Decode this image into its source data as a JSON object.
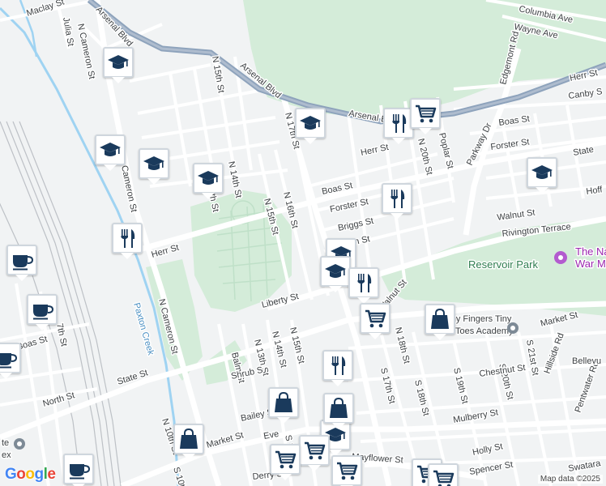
{
  "map": {
    "copyright": "Map data ©2025",
    "logo_letters": [
      "G",
      "o",
      "o",
      "g",
      "l",
      "e"
    ],
    "colors": {
      "background": "#f1f3f4",
      "road": "#ffffff",
      "arterial": "#8ea3bc",
      "park": "#d4ecd9",
      "marker_fill": "#1a3a5c",
      "rail": "#9aa0a6"
    }
  },
  "places": {
    "reservoir_park": "Reservoir Park",
    "museum_line1": "The Na",
    "museum_line2": "War M",
    "academy_line1": "Tiny Fingers Tiny",
    "academy_line2": "Toes Academy",
    "bellevue": "Bellevu",
    "paxton_creek": "Paxton Creek",
    "state_complex_line1": "te",
    "state_complex_line2": "ex"
  },
  "streets": {
    "maclay": "Maclay St",
    "julia": "Julia St",
    "n_cameron_top": "N Cameron St",
    "arsenal_blvd_top": "Arsenal Blvd",
    "arsenal_blvd_mid": "Arsenal Blvd",
    "arsenal_blvd_right": "Arsenal B",
    "n_15th_top": "N 15th St",
    "n_17th": "N 17th St",
    "columbia": "Columbia Ave",
    "wayne": "Wayne Ave",
    "edgemont": "Edgemont Rd",
    "herr_right": "Herr St",
    "canby": "Canby S",
    "boas_right": "Boas St",
    "forster_right": "Forster St",
    "state_right": "State",
    "hoff": "Hoff",
    "parkway": "Parkway Dr",
    "poplar": "Poplar St",
    "n_20th": "N 20th St",
    "herr_mid": "Herr St",
    "cameron_mid": "Cameron St",
    "n_14th_top": "N 14th St",
    "n_13th_top": "13th St",
    "boas_mid": "Boas St",
    "forster_mid": "Forster St",
    "briggs": "Briggs St",
    "n_16th": "N 16th St",
    "n_15th_mid": "N 15th St",
    "walnut_right": "Walnut St",
    "rivington": "Rivington Terrace",
    "n_19th": "n St",
    "herr_left": "Herr St",
    "n_cameron_mid": "N Cameron St",
    "liberty": "Liberty St",
    "walnut_mid": "Walnut St",
    "north_14th": "North St",
    "n_18th": "N 18th St",
    "s_17th": "S 17th St",
    "market_right": "Market St",
    "s_21st": "S 21st St",
    "boas_left": "Boas St",
    "n_7th": "7th St",
    "n_15th_low": "N 15th St",
    "n_14th_low": "N 14th St",
    "n_13th_low": "N 13th St",
    "balm": "Balm St",
    "s_18th": "S 18th St",
    "s_19th": "S 19th St",
    "s_20th": "S 20th St",
    "chestnut": "Chestnut St",
    "hillside": "Hillside Rd",
    "pentwater": "Pentwater Rd",
    "state_left": "State St",
    "north_left": "North St",
    "shrub": "Shrub S",
    "bailey": "Bailey S",
    "mulberry": "Mulberry St",
    "n_10th": "N 10th St",
    "market_left": "Market St",
    "holly": "Holly St",
    "mayflower": "Mayflower St",
    "spencer": "Spencer St",
    "derry": "Derry St",
    "swatara": "Swatara",
    "s_10th": "S 10t",
    "s_13th": "S 13",
    "eve": "Eve"
  },
  "markers": [
    {
      "type": "school",
      "icon": "graduation-cap-icon"
    },
    {
      "type": "school",
      "icon": "graduation-cap-icon"
    },
    {
      "type": "school",
      "icon": "graduation-cap-icon"
    },
    {
      "type": "school",
      "icon": "graduation-cap-icon"
    },
    {
      "type": "school",
      "icon": "graduation-cap-icon"
    },
    {
      "type": "school",
      "icon": "graduation-cap-icon"
    },
    {
      "type": "school",
      "icon": "graduation-cap-icon"
    },
    {
      "type": "school",
      "icon": "graduation-cap-icon"
    },
    {
      "type": "school",
      "icon": "graduation-cap-icon"
    },
    {
      "type": "restaurant",
      "icon": "fork-knife-icon"
    },
    {
      "type": "restaurant",
      "icon": "fork-knife-icon"
    },
    {
      "type": "restaurant",
      "icon": "fork-knife-icon"
    },
    {
      "type": "restaurant",
      "icon": "fork-knife-icon"
    },
    {
      "type": "restaurant",
      "icon": "fork-knife-icon"
    },
    {
      "type": "grocery",
      "icon": "shopping-cart-icon"
    },
    {
      "type": "grocery",
      "icon": "shopping-cart-icon"
    },
    {
      "type": "grocery",
      "icon": "shopping-cart-icon"
    },
    {
      "type": "grocery",
      "icon": "shopping-cart-icon"
    },
    {
      "type": "grocery",
      "icon": "shopping-cart-icon"
    },
    {
      "type": "grocery",
      "icon": "shopping-cart-icon"
    },
    {
      "type": "grocery",
      "icon": "shopping-cart-icon"
    },
    {
      "type": "shopping",
      "icon": "shopping-bag-icon"
    },
    {
      "type": "shopping",
      "icon": "shopping-bag-icon"
    },
    {
      "type": "shopping",
      "icon": "shopping-bag-icon"
    },
    {
      "type": "shopping",
      "icon": "shopping-bag-icon"
    },
    {
      "type": "cafe",
      "icon": "coffee-cup-icon"
    },
    {
      "type": "cafe",
      "icon": "coffee-cup-icon"
    },
    {
      "type": "cafe",
      "icon": "coffee-cup-icon"
    },
    {
      "type": "cafe",
      "icon": "coffee-cup-icon"
    }
  ]
}
